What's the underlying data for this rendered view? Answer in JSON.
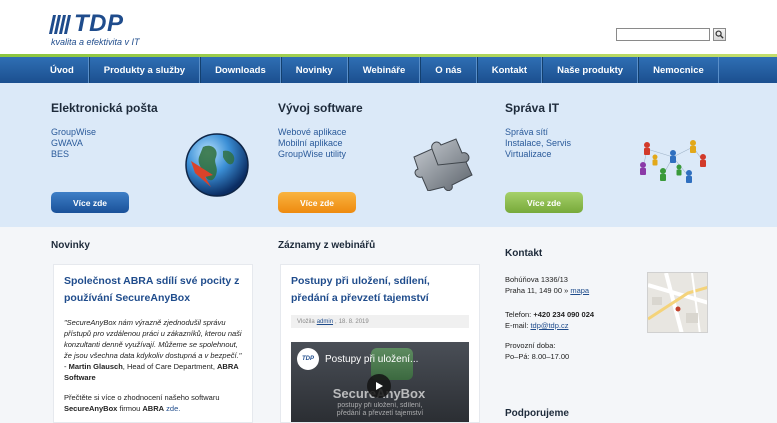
{
  "brand": {
    "name": "TDP",
    "tagline": "kvalita a efektivita v IT"
  },
  "search": {
    "placeholder": "",
    "icon": "search-icon"
  },
  "nav": {
    "items": [
      "Úvod",
      "Produkty a služby",
      "Downloads",
      "Novinky",
      "Webináře",
      "O nás",
      "Kontakt",
      "Naše produkty",
      "Nemocnice"
    ]
  },
  "banner": {
    "columns": [
      {
        "title": "Elektronická pošta",
        "items": [
          "GroupWise",
          "GWAVA",
          "BES"
        ],
        "button": "Více zde",
        "icon": "globe-icon",
        "button_color": "#1f5da6"
      },
      {
        "title": "Vývoj software",
        "items": [
          "Webové aplikace",
          "Mobilní aplikace",
          "GroupWise utility"
        ],
        "button": "Více zde",
        "icon": "puzzle-icon",
        "button_color": "#f39a1c"
      },
      {
        "title": "Správa IT",
        "items": [
          "Správa sítí",
          "Instalace, Servis",
          "Virtualizace"
        ],
        "button": "Více zde",
        "icon": "network-figures-icon",
        "button_color": "#8dbd50"
      }
    ]
  },
  "novinky": {
    "title": "Novinky",
    "article": {
      "heading": "Společnost ABRA sdílí své pocity z používání SecureAnyBox",
      "quote": "\"SecureAnyBox nám výrazně zjednodušil správu přístupů pro vzdálenou práci u zákazníků, kterou naši konzultanti denně využívají. Můžeme se spolehnout, že jsou všechna data kdykoliv dostupná a v bezpečí.\"",
      "author": "Martin Glausch",
      "author_role": ", Head of Care Department,",
      "company": "ABRA Software",
      "more_prefix": "Přečtěte si více o zhodnocení našeho softwaru",
      "product": "SecureAnyBox",
      "more_mid": "firmou",
      "more_company": "ABRA",
      "more_link": "zde."
    }
  },
  "webinare": {
    "title": "Záznamy z webinářů",
    "article": {
      "heading": "Postupy při uložení, sdílení, předání a převzetí tajemství",
      "meta_prefix": "Vložila",
      "meta_author": "admin",
      "meta_date": "18. 8. 2019",
      "video_channel": "TDP",
      "video_title": "Postupy při uložení...",
      "video_brand": "SecureAnyBox",
      "video_caption": "postupy při uložení, sdílení, předání a převzetí tajemství"
    }
  },
  "contact": {
    "title": "Kontakt",
    "street": "Bohúňova 1336/13",
    "city": "Praha 11, 149 00 »",
    "map_link": "mapa",
    "phone_label": "Telefon:",
    "phone": "+420 234 090 024",
    "email_label": "E-mail:",
    "email": "tdp@tdp.cz",
    "hours_label": "Provozní doba:",
    "hours": "Po–Pá: 8.00–17.00",
    "support_title": "Podporujeme"
  },
  "colors": {
    "brand_blue": "#1f4c8c",
    "nav_blue": "#2461a5",
    "accent_green": "#8cc63f",
    "banner_bg": "#dbe9f8"
  }
}
